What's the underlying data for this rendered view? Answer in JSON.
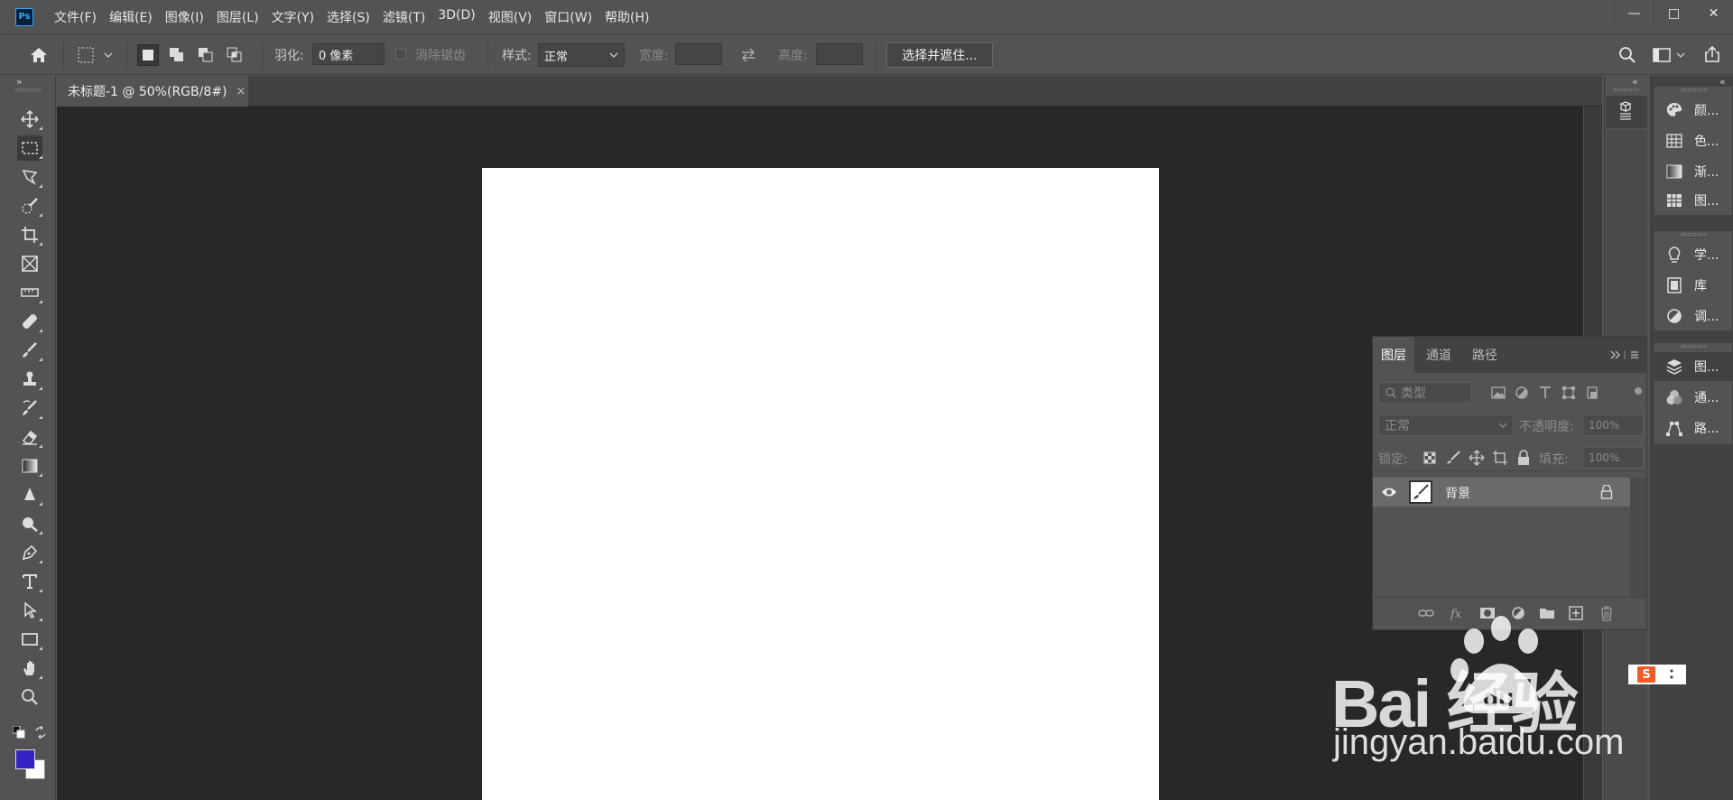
{
  "app": {
    "logo_text": "Ps"
  },
  "menu": [
    "文件(F)",
    "编辑(E)",
    "图像(I)",
    "图层(L)",
    "文字(Y)",
    "选择(S)",
    "滤镜(T)",
    "3D(D)",
    "视图(V)",
    "窗口(W)",
    "帮助(H)"
  ],
  "window_controls": {
    "minimize": "—",
    "maximize": "□",
    "close": "✕"
  },
  "options": {
    "feather_label": "羽化:",
    "feather_value": "0 像素",
    "antialias_label": "消除锯齿",
    "style_label": "样式:",
    "style_value": "正常",
    "width_label": "宽度:",
    "height_label": "高度:",
    "select_mask_button": "选择并遮住..."
  },
  "document": {
    "tab_title": "未标题-1 @ 50%(RGB/8#)",
    "close_glyph": "×"
  },
  "colors": {
    "foreground": "#3623c6",
    "background": "#ffffff",
    "accent": "#31a8ff"
  },
  "dock": {
    "group1": [
      "颜...",
      "色...",
      "渐...",
      "图..."
    ],
    "group2": [
      "学...",
      "库",
      "调..."
    ],
    "group3": [
      "图...",
      "通...",
      "路..."
    ]
  },
  "layers_panel": {
    "tabs": [
      "图层",
      "通道",
      "路径"
    ],
    "filter_placeholder": "类型",
    "blend_mode": "正常",
    "opacity_label": "不透明度:",
    "opacity_value": "100%",
    "lock_label": "锁定:",
    "fill_label": "填充:",
    "fill_value": "100%",
    "layer_name": "背景"
  },
  "watermark": {
    "brand": "Bai 经验",
    "du": "du",
    "url": "jingyan.baidu.com",
    "badge_text": "S"
  }
}
